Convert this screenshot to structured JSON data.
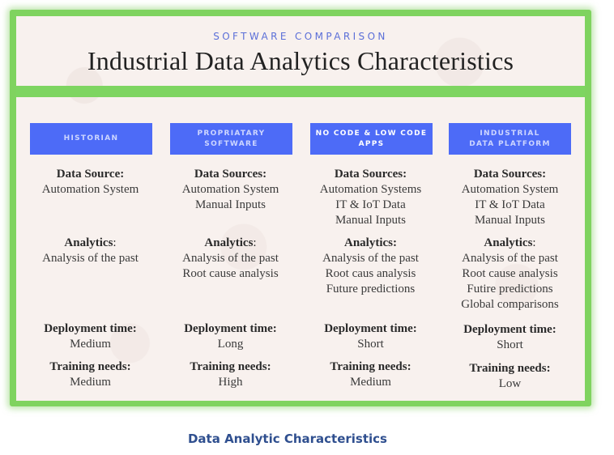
{
  "header": {
    "subtitle": "SOFTWARE COMPARISON",
    "title": "Industrial Data Analytics Characteristics"
  },
  "colors": {
    "frame_green": "#7fd35f",
    "header_blue": "#4d6bf7",
    "subtitle_blue": "#5b6fd8",
    "caption_blue": "#2f4f8f",
    "panel_bg": "#f8f1ee"
  },
  "columns": [
    {
      "heading": [
        "HISTORIAN"
      ],
      "data_source_label": "Data Source",
      "data_sources": [
        "Automation System"
      ],
      "analytics_label": "Analytics",
      "analytics": [
        "Analysis of the past"
      ],
      "deployment_label": "Deployment time",
      "deployment": "Medium",
      "training_label": "Training needs",
      "training": "Medium"
    },
    {
      "heading": [
        "PROPRIATARY",
        "SOFTWARE"
      ],
      "data_source_label": "Data Sources",
      "data_sources": [
        "Automation System",
        "Manual Inputs"
      ],
      "analytics_label": "Analytics",
      "analytics": [
        "Analysis of the past",
        "Root cause analysis"
      ],
      "deployment_label": "Deployment time",
      "deployment": "Long",
      "training_label": "Training needs",
      "training": "High"
    },
    {
      "heading": [
        "NO CODE & LOW CODE",
        "APPS"
      ],
      "data_source_label": "Data Sources",
      "data_sources": [
        "Automation Systems",
        "IT & IoT Data",
        "Manual Inputs"
      ],
      "analytics_label": "Analytics",
      "analytics": [
        "Analysis of the past",
        "Root caus analysis",
        "Future predictions"
      ],
      "deployment_label": "Deployment time",
      "deployment": "Short",
      "training_label": "Training needs",
      "training": "Medium"
    },
    {
      "heading": [
        "INDUSTRIAL",
        "DATA PLATFORM"
      ],
      "data_source_label": "Data Sources",
      "data_sources": [
        "Automation System",
        "IT & IoT Data",
        "Manual Inputs"
      ],
      "analytics_label": "Analytics",
      "analytics": [
        "Analysis of the past",
        "Root cause analysis",
        "Futire predictions",
        "Global comparisons"
      ],
      "deployment_label": "Deployment time",
      "deployment": "Short",
      "training_label": "Training needs",
      "training": "Low"
    }
  ],
  "caption": "Data Analytic Characteristics"
}
